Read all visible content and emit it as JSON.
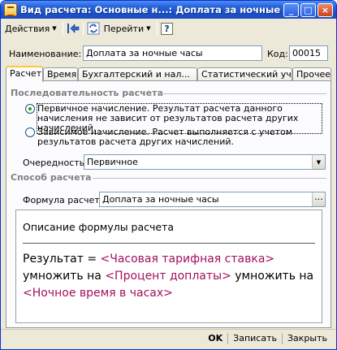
{
  "window": {
    "title": "Вид расчета: Основные н...: Доплата за ночные часы",
    "controls": {
      "minimize": "_",
      "maximize": "□",
      "close": "×"
    }
  },
  "toolbar": {
    "actions_label": "Действия",
    "goto_label": "Перейти",
    "icons": [
      "go-to-list-icon",
      "refresh-icon",
      "help-icon"
    ],
    "help_glyph": "?"
  },
  "header": {
    "name_label": "Наименование:",
    "name_value": "Доплата за ночные часы",
    "code_label": "Код:",
    "code_value": "00015"
  },
  "tabs": [
    {
      "label": "Расчеты",
      "active": true
    },
    {
      "label": "Время",
      "active": false
    },
    {
      "label": "Бухгалтерский и нал...",
      "active": false
    },
    {
      "label": "Статистический учет",
      "active": false
    },
    {
      "label": "Прочее",
      "active": false
    }
  ],
  "sequence": {
    "section_title": "Последовательность расчета",
    "option_primary": "Первичное начисление. Результат расчета данного начисления не зависит от результатов расчета других начислений.",
    "option_dependent": "Зависимое начисление. Расчет выполняется с учетом результатов расчета других начислений.",
    "selected": "primary",
    "order_label": "Очередность:",
    "order_value": "Первичное"
  },
  "method": {
    "section_title": "Способ расчета",
    "formula_label": "Формула расчета:",
    "formula_value": "Доплата за ночные часы",
    "description_title": "Описание формулы расчета",
    "desc_result": "Результат =",
    "desc_rate": "<Часовая тарифная ставка>",
    "desc_multiply1": "умножить на",
    "desc_percent": "<Процент доплаты>",
    "desc_multiply2": "умножить на",
    "desc_hours": "<Ночное время в часах>"
  },
  "buttons": {
    "ok": "OK",
    "save": "Записать",
    "close": "Закрыть"
  },
  "colors": {
    "titlebar": "#2a64dc",
    "window_bg": "#ece9d8",
    "placeholder_text": "#a01060",
    "active_tab_accent": "#ffc83c"
  }
}
